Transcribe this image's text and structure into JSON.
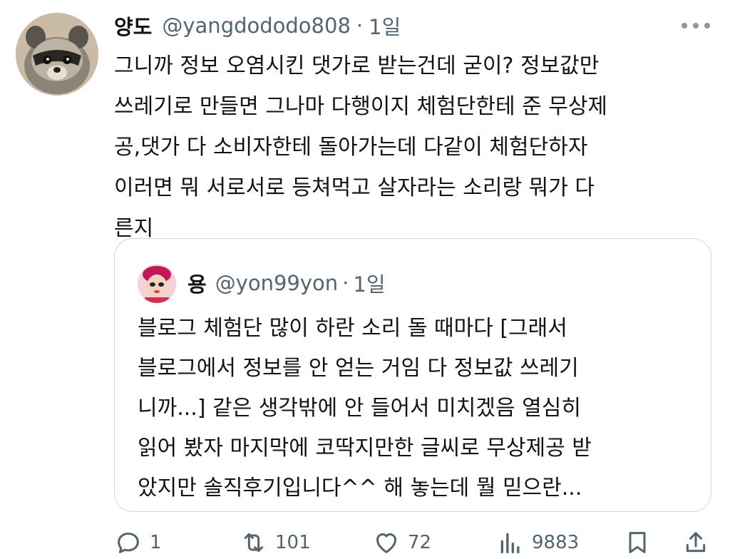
{
  "tweet": {
    "author_name": "양도",
    "author_handle": "@yangdododo808",
    "separator": "·",
    "time": "1일",
    "lines": [
      "그니까 정보 오염시킨 댓가로 받는건데 굳이? 정보값만",
      "쓰레기로 만들면 그나마 다행이지 체험단한테 준 무상제",
      "공,댓가 다 소비자한테 돌아가는데 다같이 체험단하자",
      "이러면 뭐 서로서로 등쳐먹고 살자라는 소리랑 뭐가 다",
      "른지"
    ]
  },
  "quote": {
    "author_name": "용",
    "author_handle": "@yon99yon",
    "separator": "·",
    "time": "1일",
    "lines": [
      "블로그 체험단 많이 하란 소리 돌 때마다 [그래서",
      "블로그에서 정보를 안 얻는 거임 다 정보값 쓰레기",
      "니까...] 같은 생각밖에 안 들어서 미치겠음 열심히",
      "읽어 봤자 마지막에 코딱지만한 글씨로 무상제공 받",
      "았지만 솔직후기입니다^^ 해 놓는데 뭘 믿으란..."
    ]
  },
  "actions": {
    "reply_count": "1",
    "retweet_count": "101",
    "like_count": "72",
    "view_count": "9883"
  },
  "icons": {
    "more": "more-horizontal-icon",
    "reply": "reply-icon",
    "retweet": "retweet-icon",
    "like": "heart-icon",
    "views": "views-icon",
    "bookmark": "bookmark-icon",
    "share": "share-icon"
  },
  "colors": {
    "text": "#0f1419",
    "secondary": "#536471",
    "border": "#cfd9de"
  }
}
